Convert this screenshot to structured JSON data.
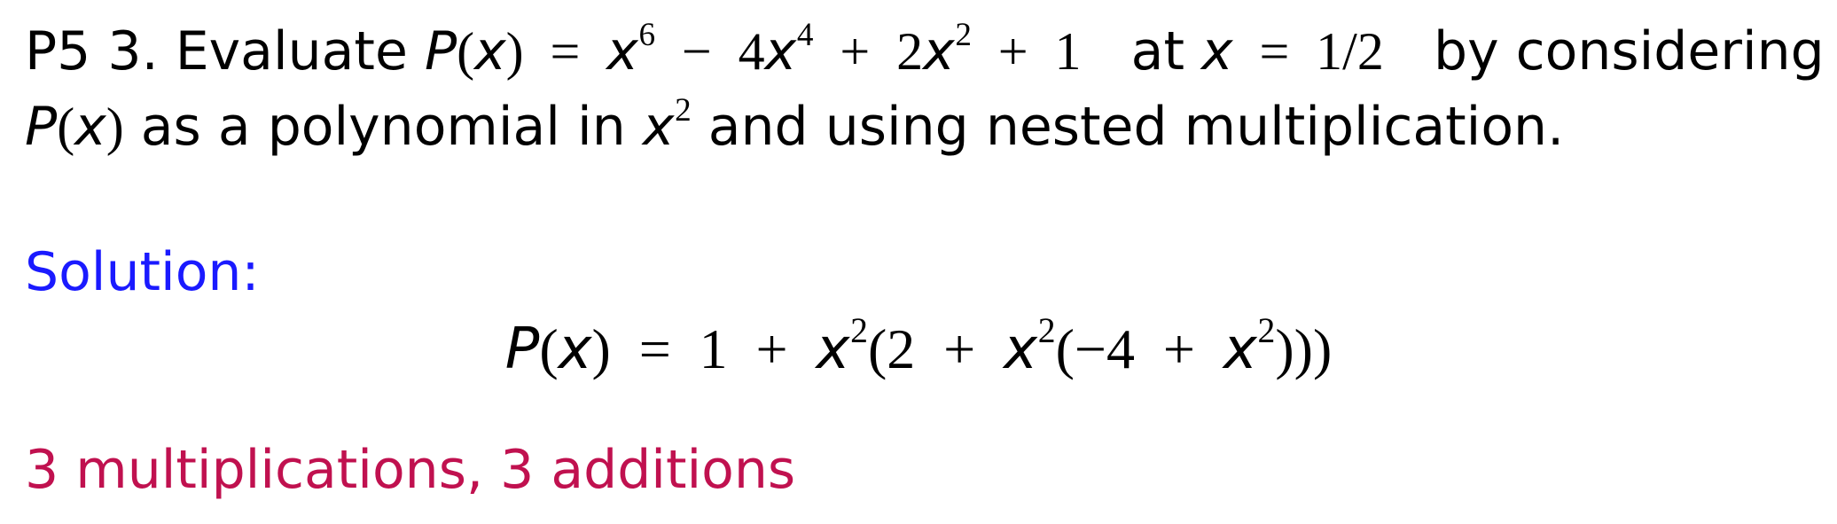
{
  "problem": {
    "label": "P5 3.",
    "evaluate_word": "Evaluate",
    "poly_name": "P",
    "var": "x",
    "lparen": "(",
    "rparen": ")",
    "equals": "=",
    "minus": "−",
    "plus": "+",
    "exp6": "6",
    "exp4": "4",
    "exp2": "2",
    "coef4": "4",
    "coef2": "2",
    "const1": "1",
    "at_word": "at",
    "value": "1/2",
    "by_considering": "by considering",
    "as_poly_in": "as a polynomial in",
    "and_using": "and using nested multiplication."
  },
  "solution": {
    "label": "Solution:",
    "label_color": "#1a1aff",
    "formula": {
      "poly_name": "P",
      "var": "x",
      "equals": "=",
      "one": "1",
      "plus": "+",
      "exp2": "2",
      "open": "(",
      "two": "2",
      "neg_four": "−4",
      "close2": "))",
      "close_inner": ")"
    }
  },
  "result": {
    "text": "3 multiplications, 3 additions",
    "color": "#c0114f"
  }
}
